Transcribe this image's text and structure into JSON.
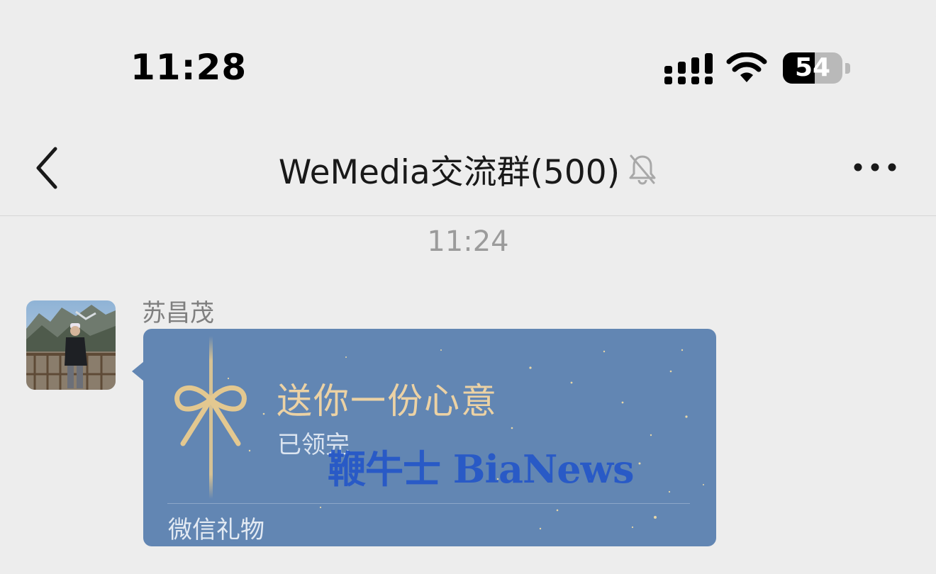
{
  "status_bar": {
    "time": "11:28",
    "battery_level": "54",
    "signal_icon": "cellular-signal-icon",
    "wifi_icon": "wifi-icon"
  },
  "nav": {
    "title": "WeMedia交流群(500)",
    "back_icon": "chevron-left-icon",
    "mute_icon": "bell-slash-icon",
    "more_icon": "ellipsis-icon"
  },
  "chat": {
    "timestamp": "11:24",
    "messages": [
      {
        "sender": "苏昌茂",
        "type": "gift",
        "gift": {
          "title": "送你一份心意",
          "status": "已领完",
          "footer": "微信礼物"
        }
      }
    ]
  },
  "watermark": "鞭牛士 BiaNews",
  "colors": {
    "background": "#ededed",
    "gift_card": "#6286b3",
    "gift_gold": "#ecd2a4",
    "watermark": "#2557c8"
  }
}
